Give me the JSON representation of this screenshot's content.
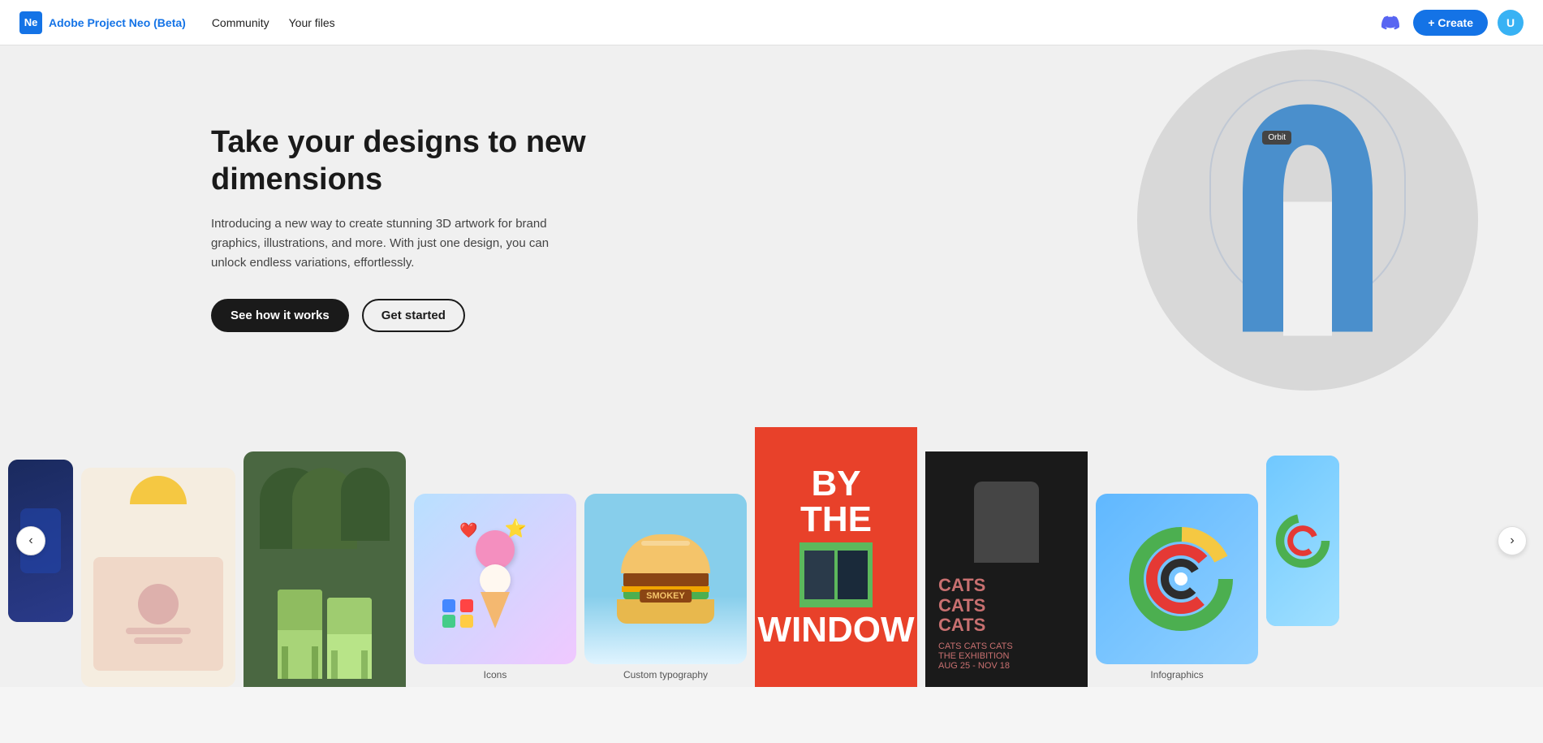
{
  "navbar": {
    "logo_badge": "Ne",
    "logo_text_adobe": "Adobe",
    "logo_text_project": " Project Neo (Beta)",
    "nav_community": "Community",
    "nav_your_files": "Your files",
    "create_label": "+ Create"
  },
  "hero": {
    "title": "Take your designs to new dimensions",
    "description": "Introducing a new way to create stunning 3D artwork for brand graphics, illustrations, and more. With just one design, you can unlock endless variations, effortlessly.",
    "btn_see_how": "See how it works",
    "btn_get_started": "Get started",
    "orbit_label": "Orbit"
  },
  "gallery": {
    "nav_prev": "‹",
    "nav_next": "›",
    "cards": [
      {
        "id": "partial-left",
        "type": "partial-left",
        "label": ""
      },
      {
        "id": "tshirt",
        "type": "tshirt",
        "label": ""
      },
      {
        "id": "chairs",
        "type": "chairs",
        "label": ""
      },
      {
        "id": "icons",
        "type": "icons",
        "label": "Icons"
      },
      {
        "id": "burger",
        "type": "burger",
        "label": "Custom typography"
      },
      {
        "id": "poster",
        "type": "poster",
        "label": ""
      },
      {
        "id": "cats",
        "type": "cats",
        "label": ""
      },
      {
        "id": "infographics",
        "type": "infographics",
        "label": "Infographics"
      },
      {
        "id": "partial-right",
        "type": "partial-right",
        "label": ""
      }
    ],
    "poster_text": [
      "BY",
      "THE",
      "WINDOW"
    ],
    "cats_text": [
      "CATS",
      "CATS",
      "CATS"
    ],
    "cats_subtitle": "CATS CATS CATS\nTHE EXHIBITION\nAUG 25 - NOV 18",
    "burger_label": "SMOKEY"
  }
}
